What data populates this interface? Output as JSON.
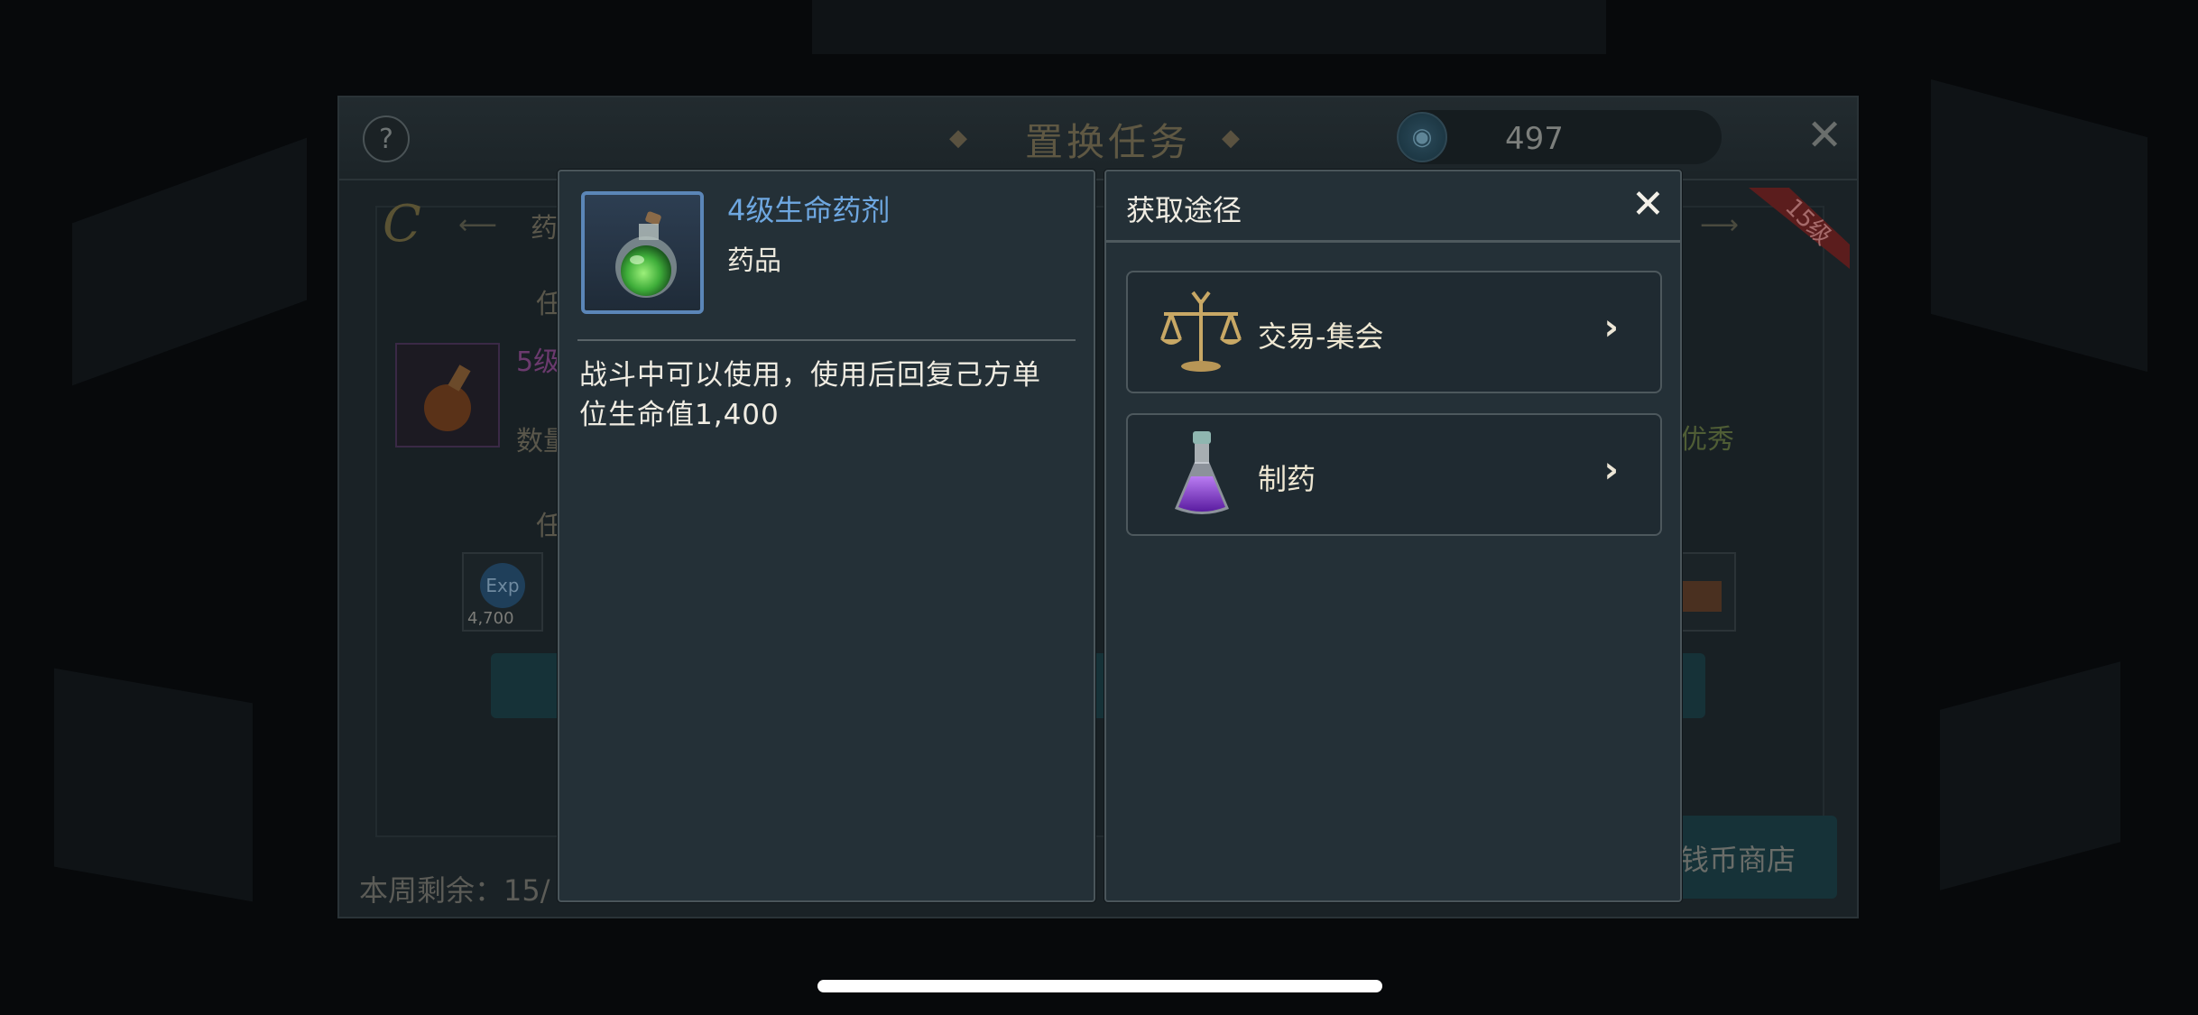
{
  "background_window": {
    "help_label": "?",
    "title": "置换任务",
    "currency_value": "497",
    "close_label": "✕",
    "category_letter": "C",
    "category_text": "药",
    "task_label_1": "任",
    "task_label_2": "任",
    "item_level_text": "5级",
    "quantity_text": "数量",
    "excellent_text": "优秀",
    "exp_icon_text": "Exp",
    "exp_value": "4,700",
    "ribbon_text": "15级",
    "weekly_remaining": "本周剩余：15/",
    "shop_label": "钱币商店"
  },
  "item_detail": {
    "name": "4级生命药剂",
    "type": "药品",
    "description": "战斗中可以使用，使用后回复己方单位生命值1,400"
  },
  "acquisition": {
    "title": "获取途径",
    "close_label": "✕",
    "sources": [
      {
        "label": "交易-集会",
        "icon": "scales-icon",
        "arrow": "›"
      },
      {
        "label": "制药",
        "icon": "purple-potion-icon",
        "arrow": "›"
      }
    ]
  }
}
